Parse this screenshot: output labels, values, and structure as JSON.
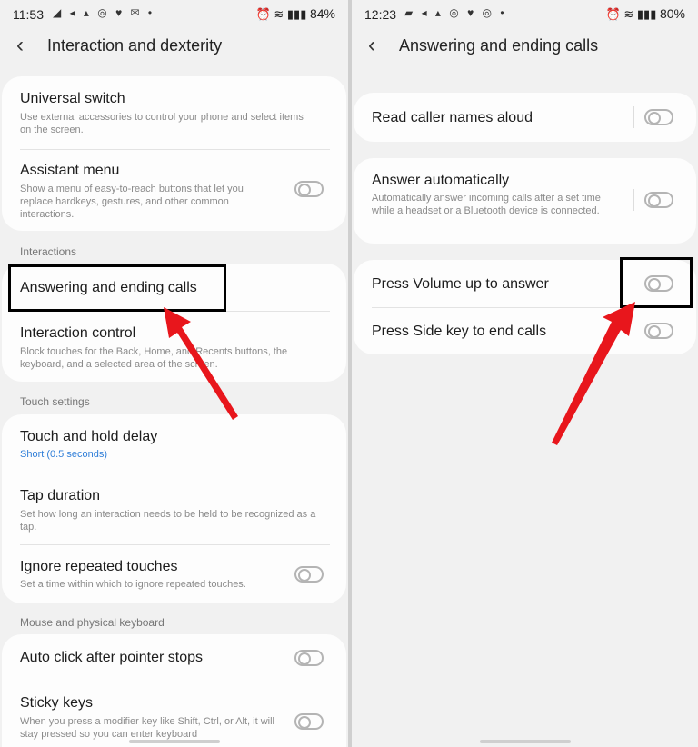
{
  "left": {
    "status": {
      "time": "11:53",
      "icons": "◢ ◂ ▴ ◎ ♥ ✉ •",
      "right_icons": "⏰ ≋ ▮▮▮",
      "battery": "84%"
    },
    "title": "Interaction and dexterity",
    "items": {
      "universal_switch": {
        "title": "Universal switch",
        "sub": "Use external accessories to control your phone and select items on the screen."
      },
      "assistant_menu": {
        "title": "Assistant menu",
        "sub": "Show a menu of easy-to-reach buttons that let you replace hardkeys, gestures, and other common interactions."
      },
      "answering": {
        "title": "Answering and ending calls"
      },
      "interaction_control": {
        "title": "Interaction control",
        "sub": "Block touches for the Back, Home, and Recents buttons, the keyboard, and a selected area of the screen."
      },
      "touch_hold": {
        "title": "Touch and hold delay",
        "sub": "Short (0.5 seconds)"
      },
      "tap_duration": {
        "title": "Tap duration",
        "sub": "Set how long an interaction needs to be held to be recognized as a tap."
      },
      "ignore_repeated": {
        "title": "Ignore repeated touches",
        "sub": "Set a time within which to ignore repeated touches."
      },
      "auto_click": {
        "title": "Auto click after pointer stops"
      },
      "sticky_keys": {
        "title": "Sticky keys",
        "sub": "When you press a modifier key like Shift, Ctrl, or Alt, it will stay pressed so you can enter keyboard"
      }
    },
    "sections": {
      "interactions": "Interactions",
      "touch_settings": "Touch settings",
      "mouse_keyboard": "Mouse and physical keyboard"
    }
  },
  "right": {
    "status": {
      "time": "12:23",
      "icons": "▰ ◂ ▴ ◎ ♥ ◎ •",
      "right_icons": "⏰ ≋ ▮▮▮",
      "battery": "80%"
    },
    "title": "Answering and ending calls",
    "items": {
      "read_caller": {
        "title": "Read caller names aloud"
      },
      "answer_auto": {
        "title": "Answer automatically",
        "sub": "Automatically answer incoming calls after a set time while a headset or a Bluetooth device is connected."
      },
      "press_volume": {
        "title": "Press Volume up to answer"
      },
      "press_side": {
        "title": "Press Side key to end calls"
      }
    }
  },
  "colors": {
    "annotation_arrow": "#e8161c",
    "highlight_box": "#000000",
    "subtitle_blue": "#2f7ed8"
  },
  "toggles": {
    "assistant_menu": false,
    "ignore_repeated": false,
    "auto_click": false,
    "sticky_keys": false,
    "read_caller": false,
    "answer_auto": false,
    "press_volume": false,
    "press_side": false
  }
}
